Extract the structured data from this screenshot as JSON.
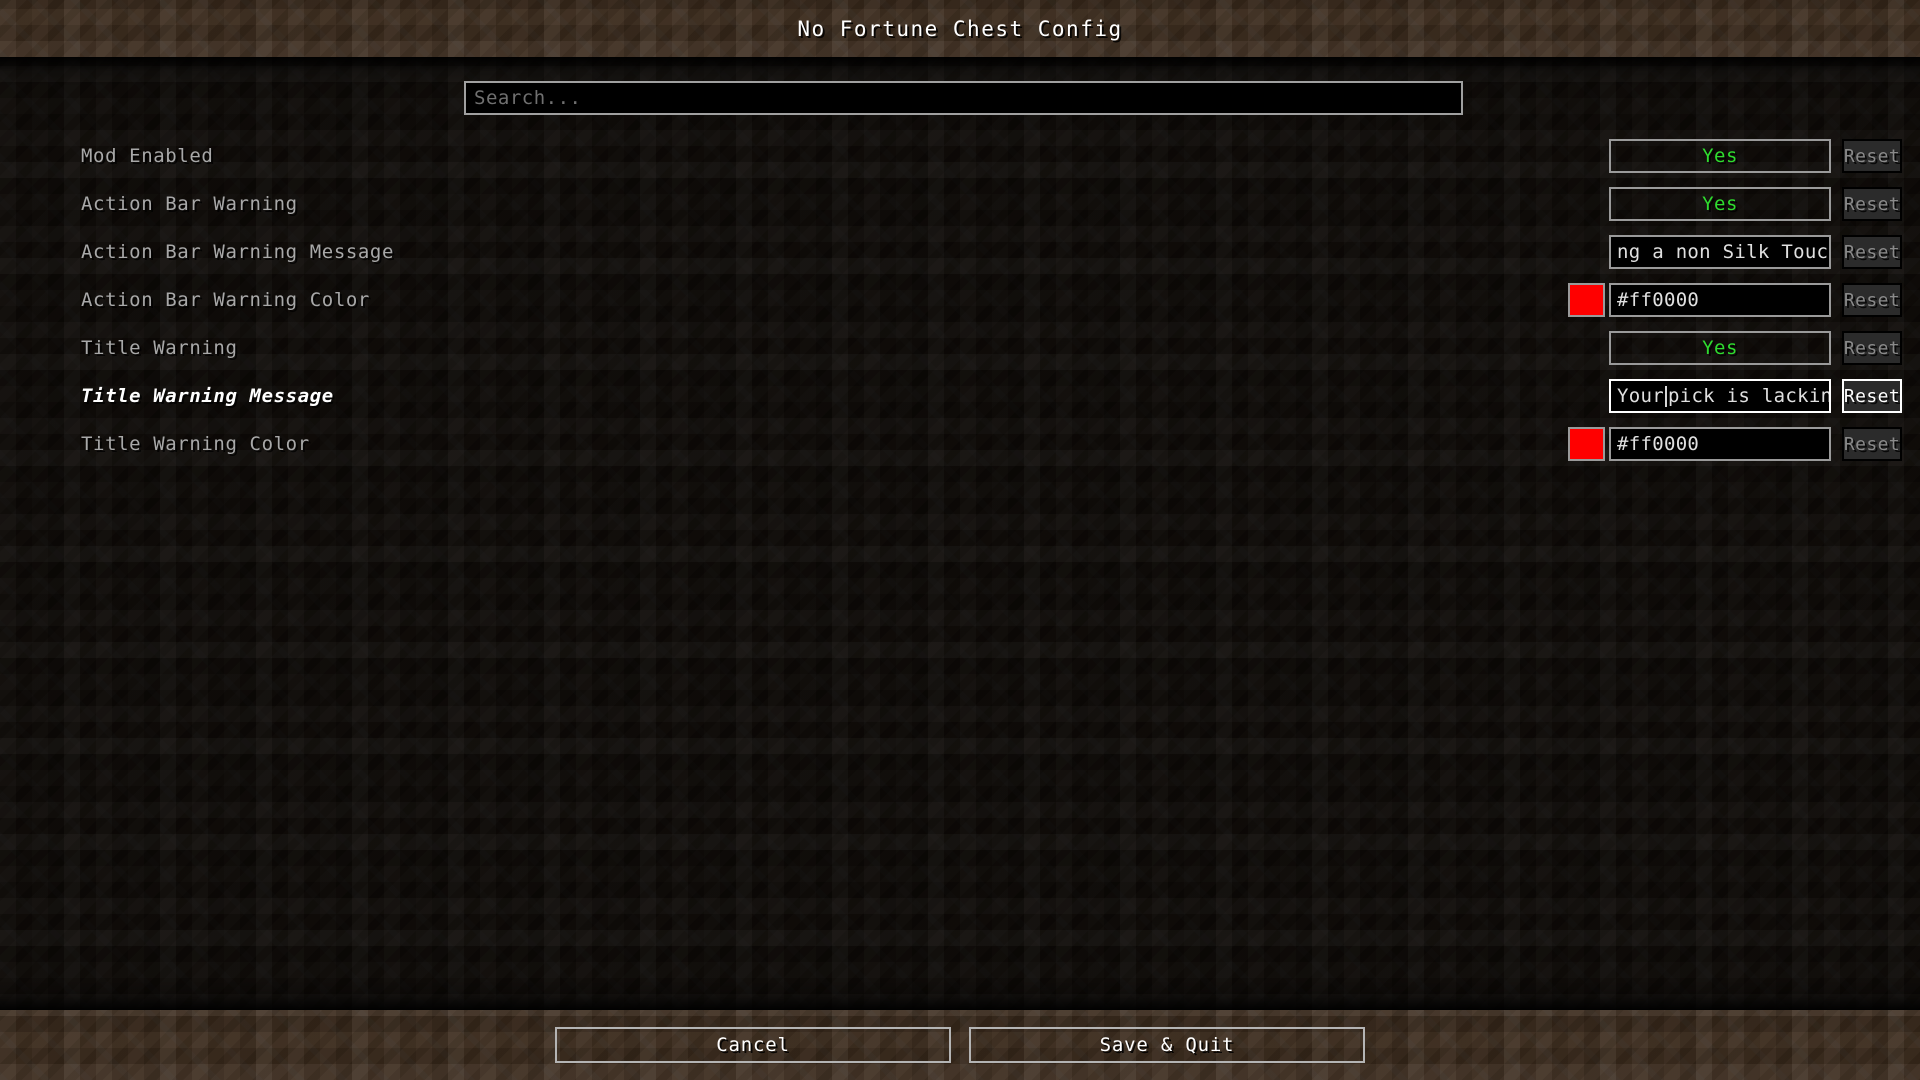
{
  "header": {
    "title": "No Fortune Chest Config"
  },
  "search": {
    "placeholder": "Search...",
    "value": ""
  },
  "colors": {
    "label_default": "#a8a8a8",
    "label_modified": "#ffffff",
    "boolean_true": "#2fdc2f",
    "border_normal": "#9a9a9a",
    "border_focused": "#ffffff",
    "field_background": "#000000"
  },
  "rows": [
    {
      "label": "Mod Enabled",
      "type": "boolean",
      "value": "Yes",
      "modified": false,
      "reset_label": "Reset",
      "reset_enabled": false
    },
    {
      "label": "Action Bar Warning",
      "type": "boolean",
      "value": "Yes",
      "modified": false,
      "reset_label": "Reset",
      "reset_enabled": false
    },
    {
      "label": "Action Bar Warning Message",
      "type": "text",
      "value": "ng a non Silk Touch ",
      "caret": "end",
      "focused": false,
      "modified": false,
      "reset_label": "Reset",
      "reset_enabled": false
    },
    {
      "label": "Action Bar Warning Color",
      "type": "color",
      "value": "#ff0000",
      "swatch": "#ff0000",
      "modified": false,
      "reset_label": "Reset",
      "reset_enabled": false
    },
    {
      "label": "Title Warning",
      "type": "boolean",
      "value": "Yes",
      "modified": false,
      "reset_label": "Reset",
      "reset_enabled": false
    },
    {
      "label": "Title Warning Message",
      "type": "text",
      "value_before_caret": "Your",
      "value_after_caret": "pick is lacking.",
      "caret": "inline",
      "focused": true,
      "modified": true,
      "reset_label": "Reset",
      "reset_enabled": true
    },
    {
      "label": "Title Warning Color",
      "type": "color",
      "value": "#ff0000",
      "swatch": "#ff0000",
      "modified": false,
      "reset_label": "Reset",
      "reset_enabled": false
    }
  ],
  "footer": {
    "cancel_label": "Cancel",
    "save_label": "Save & Quit"
  }
}
